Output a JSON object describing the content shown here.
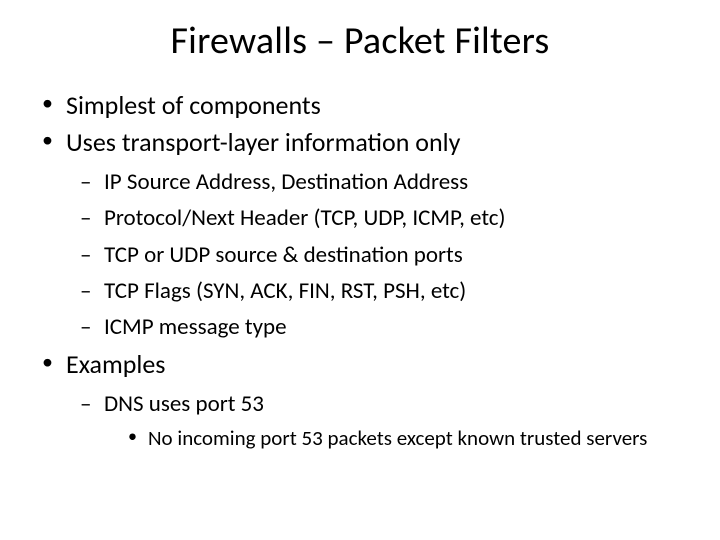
{
  "title": "Firewalls – Packet Filters",
  "bullets": {
    "b1": "Simplest of components",
    "b2": "Uses transport-layer information only",
    "b2_sub": {
      "s1": "IP Source Address, Destination Address",
      "s2": "Protocol/Next Header (TCP, UDP, ICMP, etc)",
      "s3": "TCP or UDP source & destination ports",
      "s4": "TCP Flags (SYN, ACK, FIN, RST, PSH, etc)",
      "s5": "ICMP message type"
    },
    "b3": "Examples",
    "b3_sub": {
      "s1": "DNS uses port 53",
      "s1_sub": {
        "t1": "No incoming port 53 packets except known trusted servers"
      }
    }
  }
}
